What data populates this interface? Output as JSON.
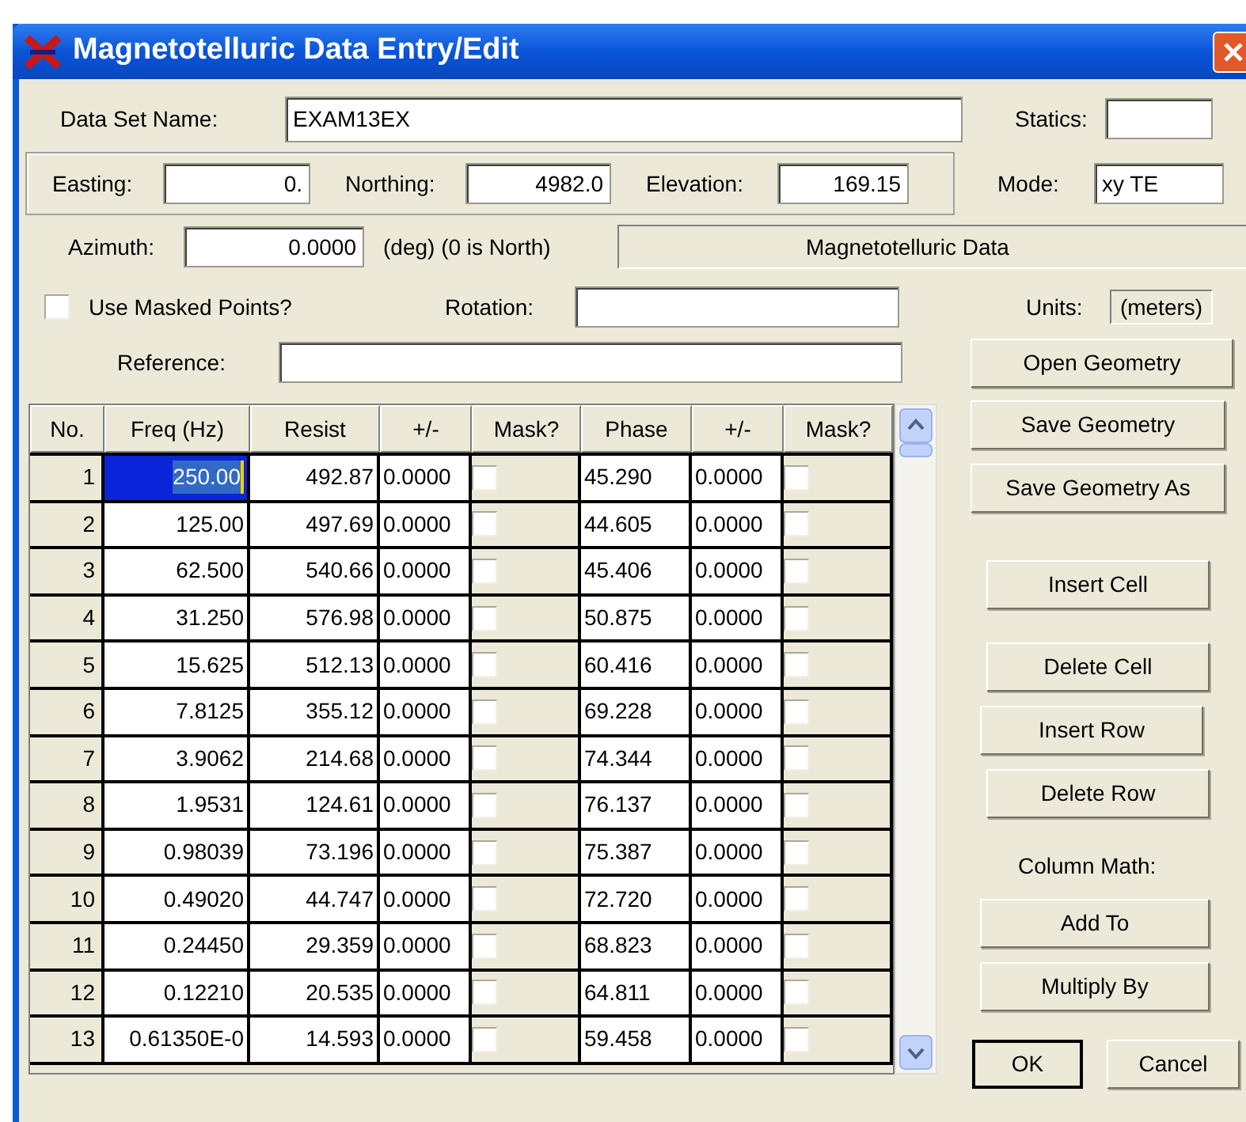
{
  "window": {
    "title": "Magnetotelluric Data Entry/Edit"
  },
  "header": {
    "data_set_name_label": "Data Set Name:",
    "data_set_name": "EXAM13EX",
    "statics_label": "Statics:",
    "easting_label": "Easting:",
    "easting": "0.",
    "northing_label": "Northing:",
    "northing": "4982.0",
    "elevation_label": "Elevation:",
    "elevation": "169.15",
    "mode_label": "Mode:",
    "mode": "xy TE",
    "azimuth_label": "Azimuth:",
    "azimuth": "0.0000",
    "azimuth_note": "(deg) (0 is North)",
    "data_type": "Magnetotelluric Data",
    "use_masked_label": "Use Masked Points?",
    "use_masked_checked": false,
    "rotation_label": "Rotation:",
    "units_label": "Units:",
    "units": "(meters)",
    "reference_label": "Reference:"
  },
  "table": {
    "columns": [
      "No.",
      "Freq (Hz)",
      "Resist",
      "+/-",
      "Mask?",
      "Phase",
      "+/-",
      "Mask?"
    ],
    "rows": [
      {
        "no": "1",
        "freq": "250.00",
        "resist": "492.87",
        "resist_err": "0.0000",
        "resist_mask": false,
        "phase": "45.290",
        "phase_err": "0.0000",
        "phase_mask": false,
        "selected": true
      },
      {
        "no": "2",
        "freq": "125.00",
        "resist": "497.69",
        "resist_err": "0.0000",
        "resist_mask": false,
        "phase": "44.605",
        "phase_err": "0.0000",
        "phase_mask": false,
        "selected": false
      },
      {
        "no": "3",
        "freq": "62.500",
        "resist": "540.66",
        "resist_err": "0.0000",
        "resist_mask": false,
        "phase": "45.406",
        "phase_err": "0.0000",
        "phase_mask": false,
        "selected": false
      },
      {
        "no": "4",
        "freq": "31.250",
        "resist": "576.98",
        "resist_err": "0.0000",
        "resist_mask": false,
        "phase": "50.875",
        "phase_err": "0.0000",
        "phase_mask": false,
        "selected": false
      },
      {
        "no": "5",
        "freq": "15.625",
        "resist": "512.13",
        "resist_err": "0.0000",
        "resist_mask": false,
        "phase": "60.416",
        "phase_err": "0.0000",
        "phase_mask": false,
        "selected": false
      },
      {
        "no": "6",
        "freq": "7.8125",
        "resist": "355.12",
        "resist_err": "0.0000",
        "resist_mask": false,
        "phase": "69.228",
        "phase_err": "0.0000",
        "phase_mask": false,
        "selected": false
      },
      {
        "no": "7",
        "freq": "3.9062",
        "resist": "214.68",
        "resist_err": "0.0000",
        "resist_mask": false,
        "phase": "74.344",
        "phase_err": "0.0000",
        "phase_mask": false,
        "selected": false
      },
      {
        "no": "8",
        "freq": "1.9531",
        "resist": "124.61",
        "resist_err": "0.0000",
        "resist_mask": false,
        "phase": "76.137",
        "phase_err": "0.0000",
        "phase_mask": false,
        "selected": false
      },
      {
        "no": "9",
        "freq": "0.98039",
        "resist": "73.196",
        "resist_err": "0.0000",
        "resist_mask": false,
        "phase": "75.387",
        "phase_err": "0.0000",
        "phase_mask": false,
        "selected": false
      },
      {
        "no": "10",
        "freq": "0.49020",
        "resist": "44.747",
        "resist_err": "0.0000",
        "resist_mask": false,
        "phase": "72.720",
        "phase_err": "0.0000",
        "phase_mask": false,
        "selected": false
      },
      {
        "no": "11",
        "freq": "0.24450",
        "resist": "29.359",
        "resist_err": "0.0000",
        "resist_mask": false,
        "phase": "68.823",
        "phase_err": "0.0000",
        "phase_mask": false,
        "selected": false
      },
      {
        "no": "12",
        "freq": "0.12210",
        "resist": "20.535",
        "resist_err": "0.0000",
        "resist_mask": false,
        "phase": "64.811",
        "phase_err": "0.0000",
        "phase_mask": false,
        "selected": false
      },
      {
        "no": "13",
        "freq": "0.61350E-0",
        "resist": "14.593",
        "resist_err": "0.0000",
        "resist_mask": false,
        "phase": "59.458",
        "phase_err": "0.0000",
        "phase_mask": false,
        "selected": false
      }
    ]
  },
  "buttons": {
    "open_geometry": "Open Geometry",
    "save_geometry": "Save Geometry",
    "save_geometry_as": "Save Geometry As",
    "insert_cell": "Insert Cell",
    "delete_cell": "Delete Cell",
    "insert_row": "Insert Row",
    "delete_row": "Delete Row",
    "column_math_label": "Column Math:",
    "add_to": "Add To",
    "multiply_by": "Multiply By",
    "ok": "OK",
    "cancel": "Cancel"
  }
}
